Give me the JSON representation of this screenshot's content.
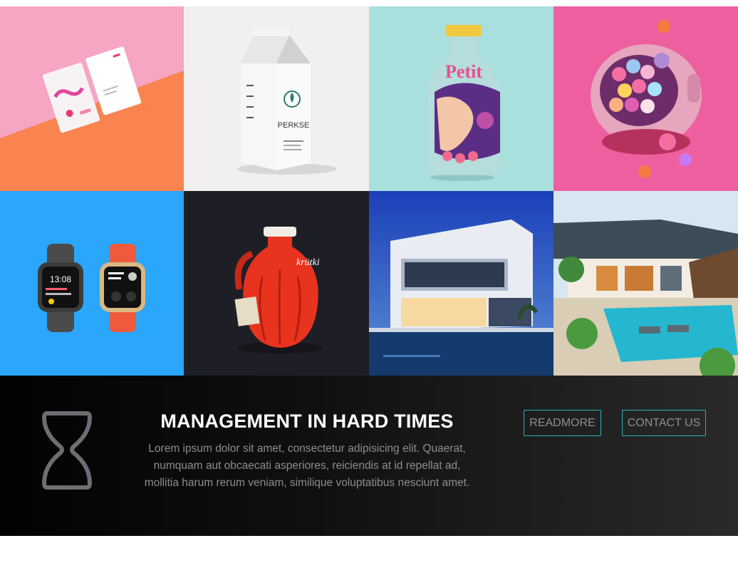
{
  "portfolio": {
    "tiles": [
      {
        "name": "business-cards"
      },
      {
        "name": "perkse-milk-carton",
        "label": "PERKSE"
      },
      {
        "name": "petit-bottle",
        "label": "Petit"
      },
      {
        "name": "gumball-helmet"
      },
      {
        "name": "smart-watches",
        "time": "13:08"
      },
      {
        "name": "krutki-red-jug",
        "label": "krütki"
      },
      {
        "name": "modern-villa-night"
      },
      {
        "name": "resort-pool-house"
      }
    ]
  },
  "promo": {
    "icon": "hourglass-icon",
    "title": "MANAGEMENT IN HARD TIMES",
    "body_lines": [
      "Lorem ipsum dolor sit amet, consectetur adipisicing elit. Quaerat,",
      "numquam aut obcaecati asperiores, reiciendis at id repellat ad,",
      "mollitia harum rerum veniam, similique voluptatibus nesciunt amet."
    ],
    "readmore_label": "READMORE",
    "contact_label": "CONTACT US",
    "accent_color": "#26b3c4"
  }
}
